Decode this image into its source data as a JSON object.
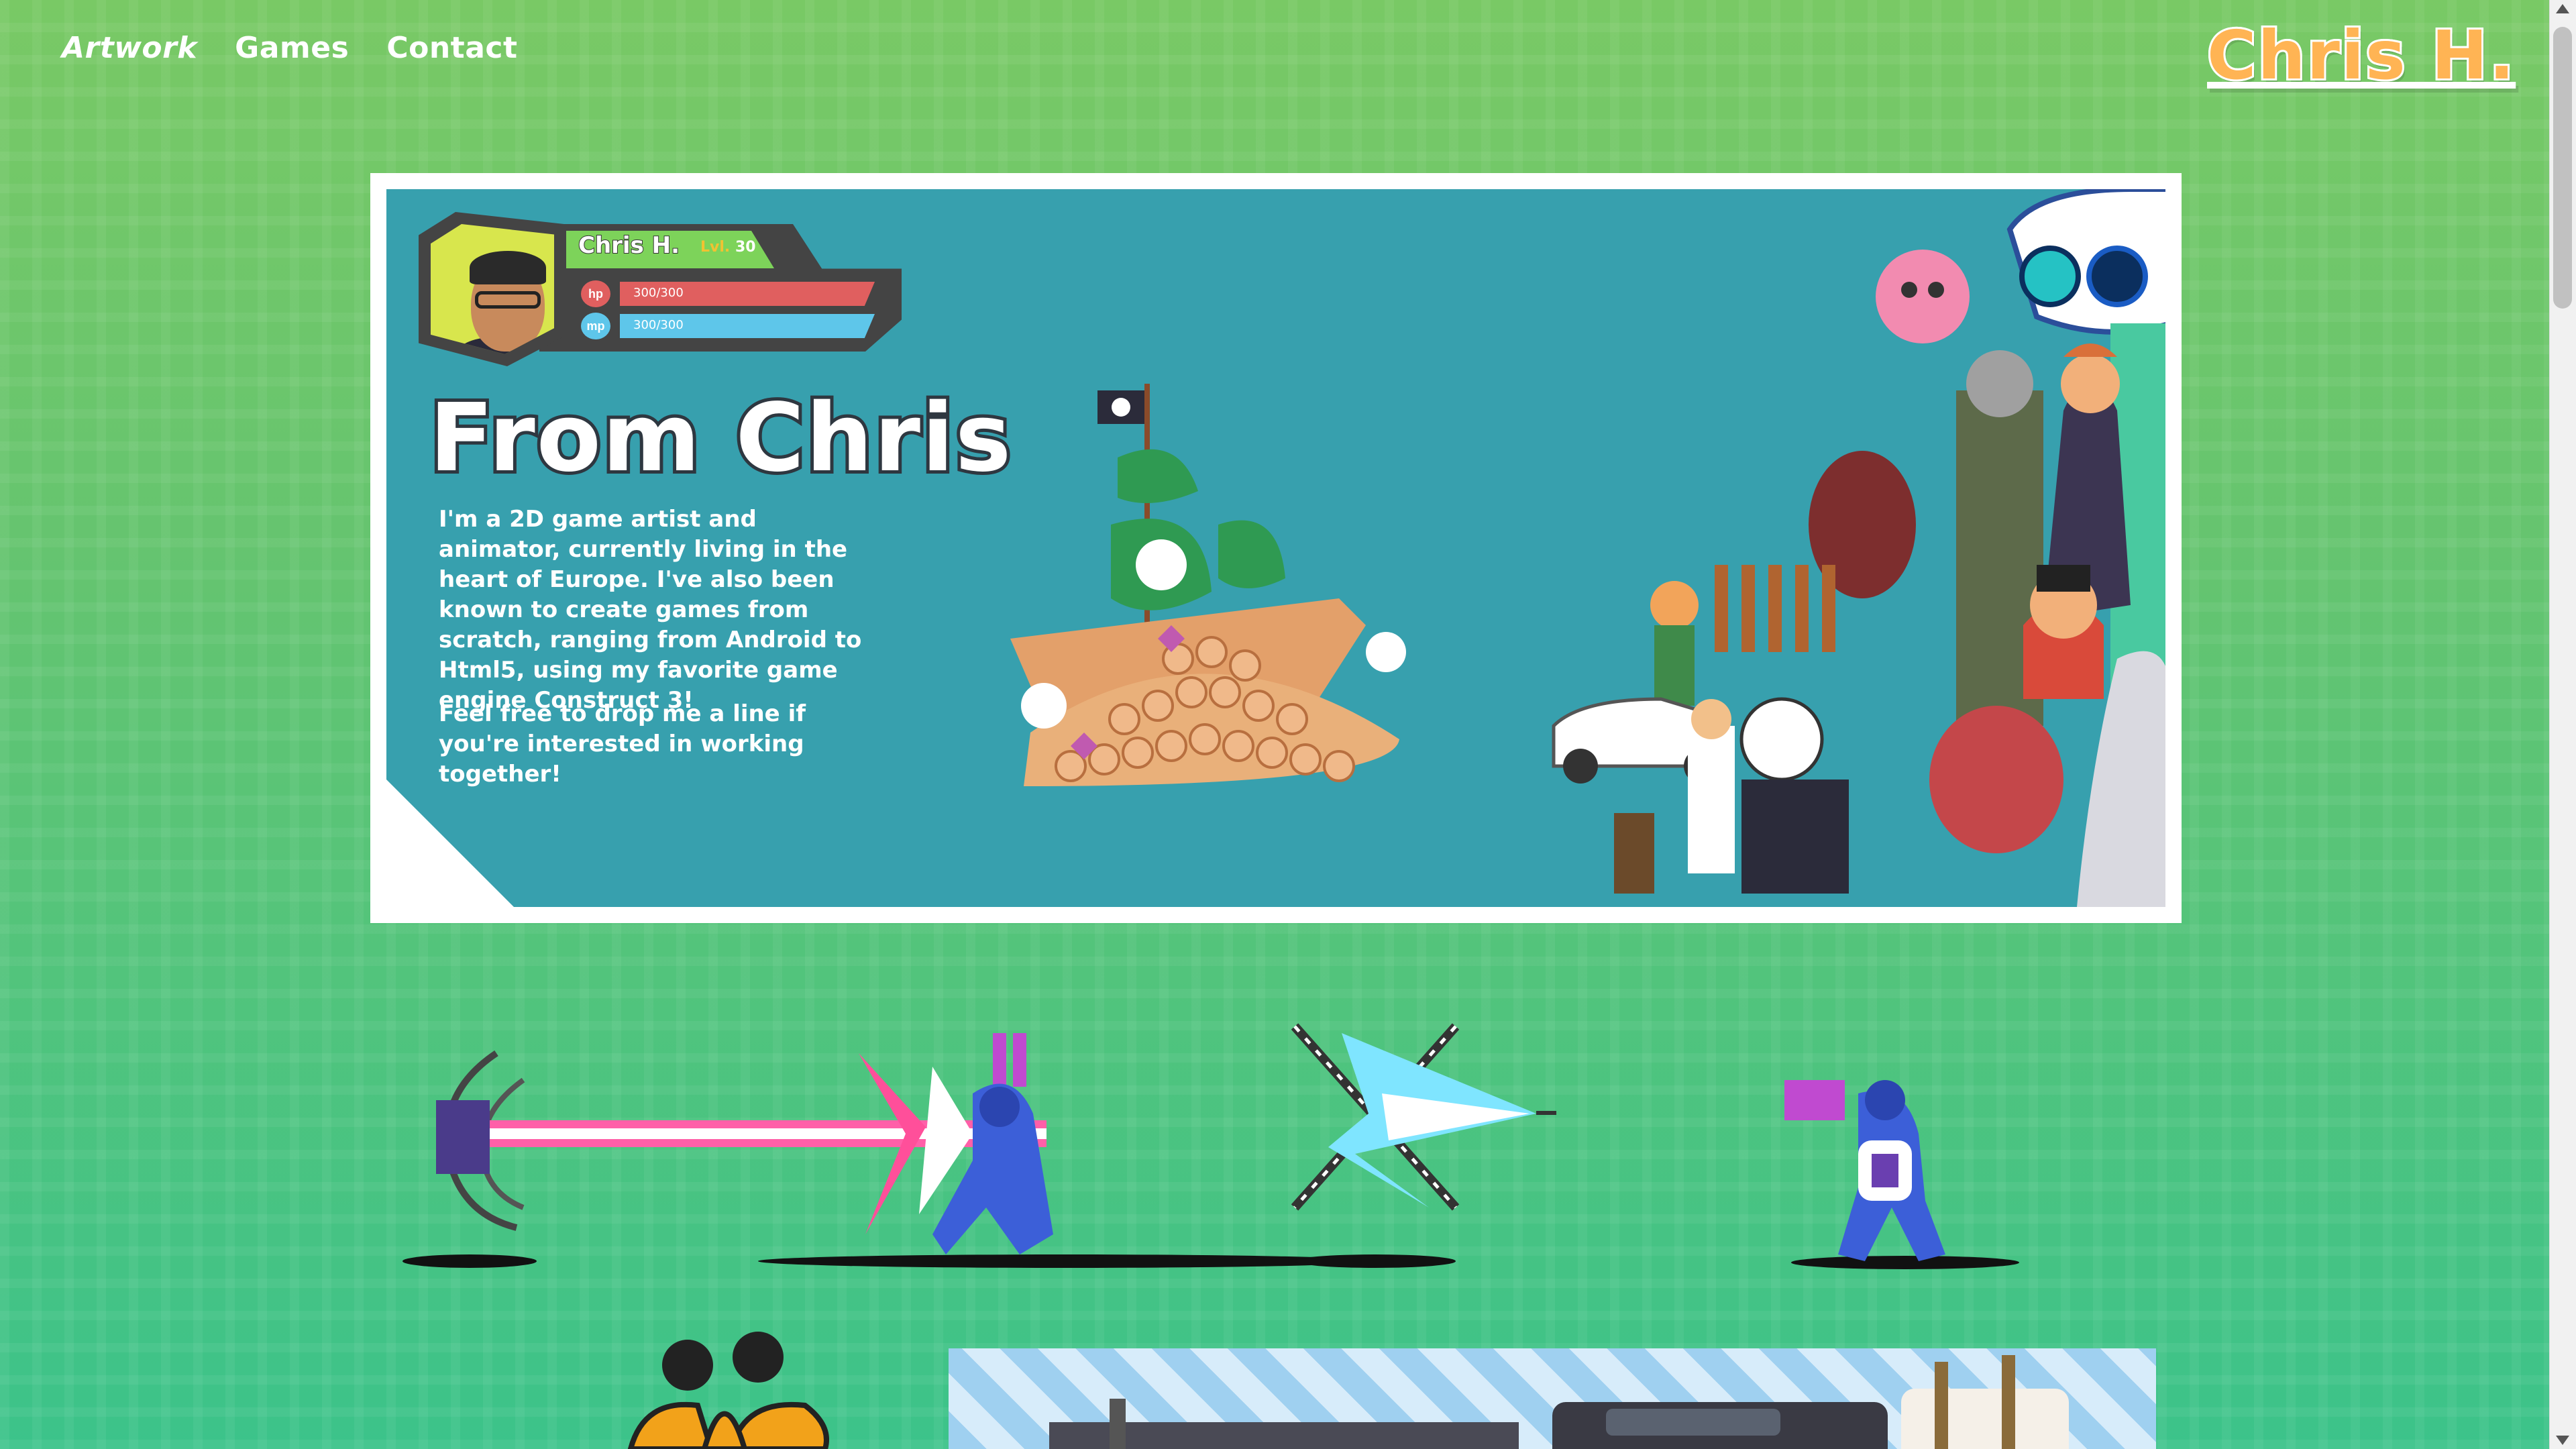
{
  "nav": {
    "items": [
      {
        "label": "Artwork",
        "active": true
      },
      {
        "label": "Games",
        "active": false
      },
      {
        "label": "Contact",
        "active": false
      }
    ]
  },
  "logo": {
    "text": "Chris H."
  },
  "hero": {
    "player_name": "Chris H.",
    "level_prefix": "Lvl.",
    "level_value": "30",
    "hp_label": "hp",
    "hp_value": "300/300",
    "mp_label": "mp",
    "mp_value": "300/300",
    "title": "From Chris",
    "paragraph1": "I'm a 2D game artist and animator, currently living in the heart of Europe. I've also been known to create games from scratch, ranging from Android to Html5, using my favorite game engine Construct 3!",
    "paragraph2": "Feel free to drop me a line if you're interested in working together!"
  },
  "colors": {
    "hero_bg": "#37a0ae",
    "logo": "#ffb454",
    "hp": "#e05f5f",
    "mp": "#5ec6ea",
    "name_bar": "#7dd35a",
    "avatar_bg": "#d8e64d"
  },
  "icons": {
    "scroll_up": "chevron-up-icon",
    "scroll_down": "chevron-down-icon"
  }
}
